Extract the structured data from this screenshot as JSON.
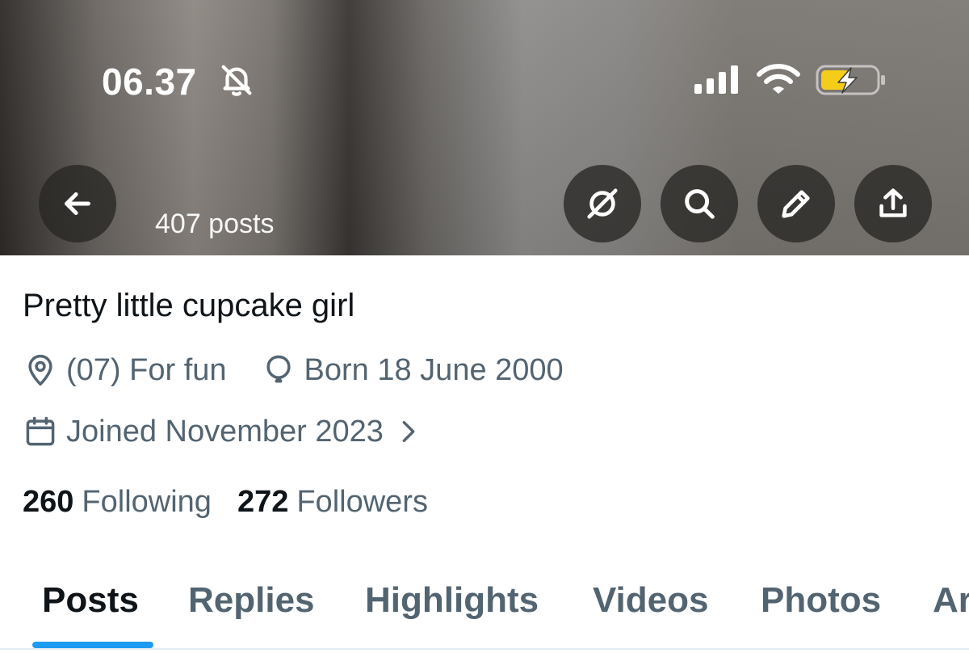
{
  "status_bar": {
    "time": "06.37",
    "icons": [
      "bell-slash-icon",
      "cellular-signal-icon",
      "wifi-icon",
      "battery-charging-icon"
    ],
    "battery_color": "#f5cc1a"
  },
  "header": {
    "posts_count": "407 posts",
    "buttons": [
      "back-arrow-icon",
      "grok-icon",
      "search-icon",
      "edit-pencil-icon",
      "share-icon"
    ]
  },
  "profile": {
    "display_name": "Pretty little cupcake girl",
    "location": "(07) For fun",
    "birthday": "Born 18 June 2000",
    "joined": "Joined November 2023",
    "following_count": "260",
    "following_label": "Following",
    "followers_count": "272",
    "followers_label": "Followers"
  },
  "tabs": [
    {
      "label": "Posts",
      "active": true
    },
    {
      "label": "Replies",
      "active": false
    },
    {
      "label": "Highlights",
      "active": false
    },
    {
      "label": "Videos",
      "active": false
    },
    {
      "label": "Photos",
      "active": false
    },
    {
      "label": "Ar",
      "active": false
    }
  ],
  "colors": {
    "accent": "#1d9bf0",
    "primary_text": "#0f1419",
    "secondary_text": "#536471"
  }
}
